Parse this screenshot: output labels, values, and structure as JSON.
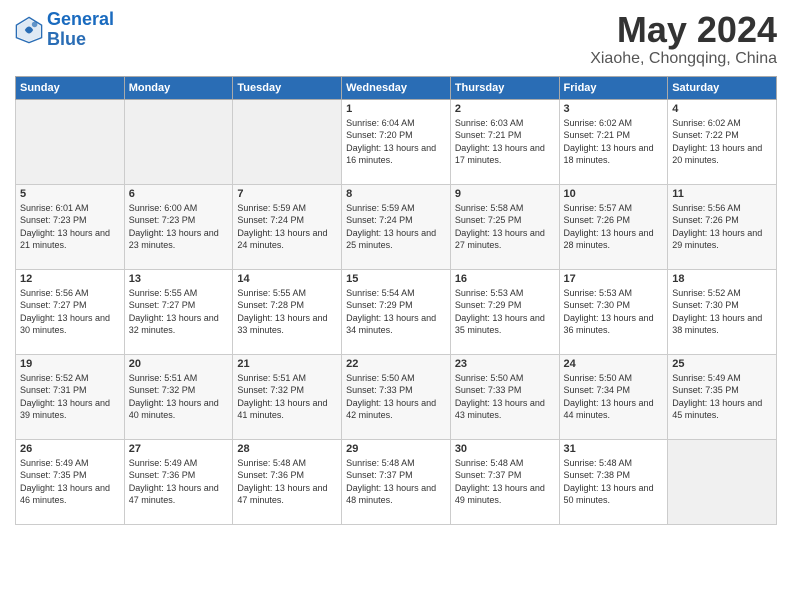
{
  "logo": {
    "text_general": "General",
    "text_blue": "Blue"
  },
  "title": "May 2024",
  "subtitle": "Xiaohe, Chongqing, China",
  "days_of_week": [
    "Sunday",
    "Monday",
    "Tuesday",
    "Wednesday",
    "Thursday",
    "Friday",
    "Saturday"
  ],
  "weeks": [
    [
      {
        "day": "",
        "empty": true
      },
      {
        "day": "",
        "empty": true
      },
      {
        "day": "",
        "empty": true
      },
      {
        "day": "1",
        "sunrise": "6:04 AM",
        "sunset": "7:20 PM",
        "daylight": "13 hours and 16 minutes."
      },
      {
        "day": "2",
        "sunrise": "6:03 AM",
        "sunset": "7:21 PM",
        "daylight": "13 hours and 17 minutes."
      },
      {
        "day": "3",
        "sunrise": "6:02 AM",
        "sunset": "7:21 PM",
        "daylight": "13 hours and 18 minutes."
      },
      {
        "day": "4",
        "sunrise": "6:02 AM",
        "sunset": "7:22 PM",
        "daylight": "13 hours and 20 minutes."
      }
    ],
    [
      {
        "day": "5",
        "sunrise": "6:01 AM",
        "sunset": "7:23 PM",
        "daylight": "13 hours and 21 minutes."
      },
      {
        "day": "6",
        "sunrise": "6:00 AM",
        "sunset": "7:23 PM",
        "daylight": "13 hours and 23 minutes."
      },
      {
        "day": "7",
        "sunrise": "5:59 AM",
        "sunset": "7:24 PM",
        "daylight": "13 hours and 24 minutes."
      },
      {
        "day": "8",
        "sunrise": "5:59 AM",
        "sunset": "7:24 PM",
        "daylight": "13 hours and 25 minutes."
      },
      {
        "day": "9",
        "sunrise": "5:58 AM",
        "sunset": "7:25 PM",
        "daylight": "13 hours and 27 minutes."
      },
      {
        "day": "10",
        "sunrise": "5:57 AM",
        "sunset": "7:26 PM",
        "daylight": "13 hours and 28 minutes."
      },
      {
        "day": "11",
        "sunrise": "5:56 AM",
        "sunset": "7:26 PM",
        "daylight": "13 hours and 29 minutes."
      }
    ],
    [
      {
        "day": "12",
        "sunrise": "5:56 AM",
        "sunset": "7:27 PM",
        "daylight": "13 hours and 30 minutes."
      },
      {
        "day": "13",
        "sunrise": "5:55 AM",
        "sunset": "7:27 PM",
        "daylight": "13 hours and 32 minutes."
      },
      {
        "day": "14",
        "sunrise": "5:55 AM",
        "sunset": "7:28 PM",
        "daylight": "13 hours and 33 minutes."
      },
      {
        "day": "15",
        "sunrise": "5:54 AM",
        "sunset": "7:29 PM",
        "daylight": "13 hours and 34 minutes."
      },
      {
        "day": "16",
        "sunrise": "5:53 AM",
        "sunset": "7:29 PM",
        "daylight": "13 hours and 35 minutes."
      },
      {
        "day": "17",
        "sunrise": "5:53 AM",
        "sunset": "7:30 PM",
        "daylight": "13 hours and 36 minutes."
      },
      {
        "day": "18",
        "sunrise": "5:52 AM",
        "sunset": "7:30 PM",
        "daylight": "13 hours and 38 minutes."
      }
    ],
    [
      {
        "day": "19",
        "sunrise": "5:52 AM",
        "sunset": "7:31 PM",
        "daylight": "13 hours and 39 minutes."
      },
      {
        "day": "20",
        "sunrise": "5:51 AM",
        "sunset": "7:32 PM",
        "daylight": "13 hours and 40 minutes."
      },
      {
        "day": "21",
        "sunrise": "5:51 AM",
        "sunset": "7:32 PM",
        "daylight": "13 hours and 41 minutes."
      },
      {
        "day": "22",
        "sunrise": "5:50 AM",
        "sunset": "7:33 PM",
        "daylight": "13 hours and 42 minutes."
      },
      {
        "day": "23",
        "sunrise": "5:50 AM",
        "sunset": "7:33 PM",
        "daylight": "13 hours and 43 minutes."
      },
      {
        "day": "24",
        "sunrise": "5:50 AM",
        "sunset": "7:34 PM",
        "daylight": "13 hours and 44 minutes."
      },
      {
        "day": "25",
        "sunrise": "5:49 AM",
        "sunset": "7:35 PM",
        "daylight": "13 hours and 45 minutes."
      }
    ],
    [
      {
        "day": "26",
        "sunrise": "5:49 AM",
        "sunset": "7:35 PM",
        "daylight": "13 hours and 46 minutes."
      },
      {
        "day": "27",
        "sunrise": "5:49 AM",
        "sunset": "7:36 PM",
        "daylight": "13 hours and 47 minutes."
      },
      {
        "day": "28",
        "sunrise": "5:48 AM",
        "sunset": "7:36 PM",
        "daylight": "13 hours and 47 minutes."
      },
      {
        "day": "29",
        "sunrise": "5:48 AM",
        "sunset": "7:37 PM",
        "daylight": "13 hours and 48 minutes."
      },
      {
        "day": "30",
        "sunrise": "5:48 AM",
        "sunset": "7:37 PM",
        "daylight": "13 hours and 49 minutes."
      },
      {
        "day": "31",
        "sunrise": "5:48 AM",
        "sunset": "7:38 PM",
        "daylight": "13 hours and 50 minutes."
      },
      {
        "day": "",
        "empty": true
      }
    ]
  ]
}
